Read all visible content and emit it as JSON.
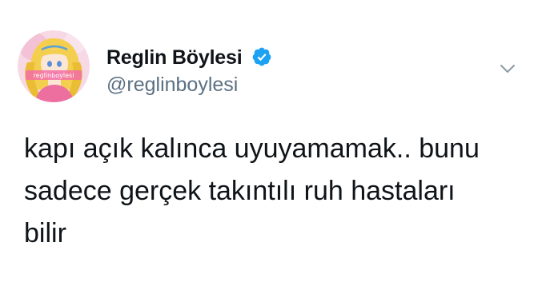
{
  "author": {
    "display_name": "Reglin Böylesi",
    "handle": "@reglinboylesi",
    "verified": true,
    "avatar_watermark": "reglinboylesi"
  },
  "tweet": {
    "text": "kapı açık kalınca uyuyamamak.. bunu\nsadece gerçek takıntılı ruh hastaları\nbilir"
  },
  "icons": {
    "verified": "verified-badge-icon",
    "more": "chevron-down-icon"
  },
  "colors": {
    "name": "#0f1419",
    "handle": "#5b7083",
    "verified": "#1da1f2",
    "avatar_background": "#f7d9e6",
    "hair": "#f4cf4f",
    "chevron": "#8899a6"
  }
}
